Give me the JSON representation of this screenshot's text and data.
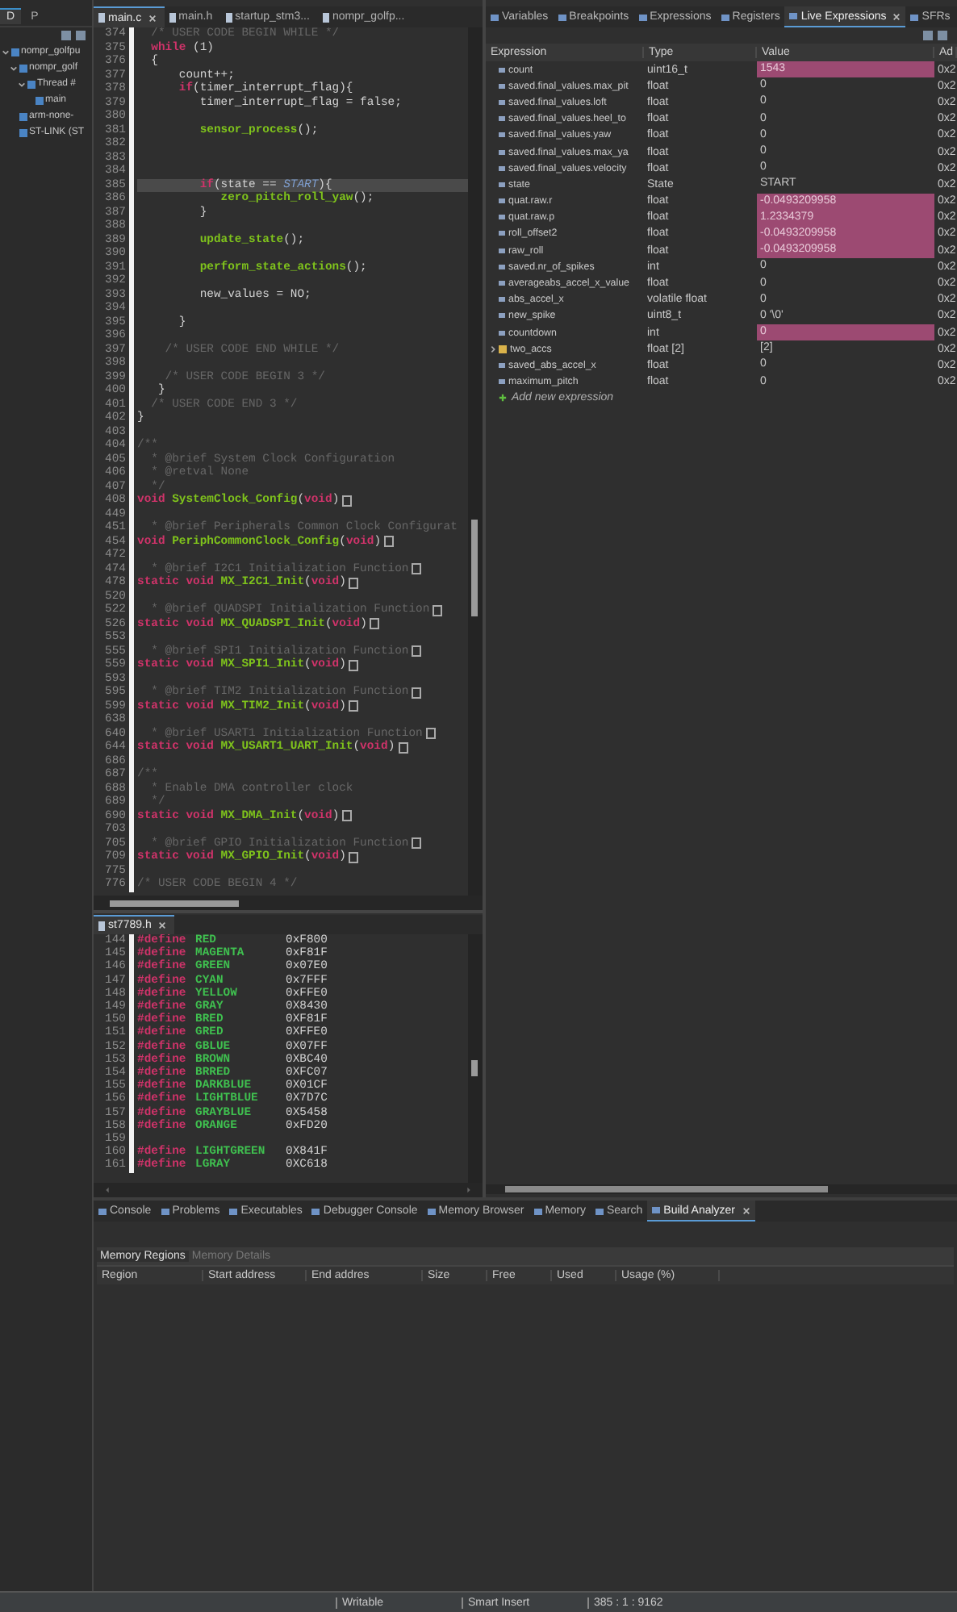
{
  "sidebar": {
    "tabs": [
      {
        "label": "D",
        "selected": true
      },
      {
        "label": "P",
        "selected": false
      }
    ],
    "tree": [
      {
        "label": "nompr_golfpu",
        "expanded": true,
        "children": [
          {
            "label": "nompr_golf",
            "expanded": true,
            "children": [
              {
                "label": "Thread #",
                "expanded": true,
                "children": [
                  {
                    "label": "main"
                  }
                ]
              }
            ]
          },
          {
            "label": "arm-none-"
          },
          {
            "label": "ST-LINK (ST"
          }
        ]
      }
    ]
  },
  "editor": {
    "tabs": [
      {
        "label": "main.c",
        "selected": true
      },
      {
        "label": "main.h",
        "selected": false
      },
      {
        "label": "startup_stm3...",
        "selected": false
      },
      {
        "label": "nompr_golfp...",
        "selected": false
      }
    ],
    "lines": [
      {
        "n": "374",
        "segs": [
          {
            "kind": "cm",
            "text": "  /* USER CODE BEGIN WHILE */"
          }
        ]
      },
      {
        "n": "375",
        "segs": [
          {
            "kind": "kw",
            "text": "  while"
          },
          {
            "kind": "tx",
            "text": " (1)"
          }
        ]
      },
      {
        "n": "376",
        "segs": [
          {
            "kind": "tx",
            "text": "  {"
          }
        ]
      },
      {
        "n": "377",
        "segs": [
          {
            "kind": "tx",
            "text": "      count++;"
          }
        ]
      },
      {
        "n": "378",
        "segs": [
          {
            "kind": "kw",
            "text": "      if"
          },
          {
            "kind": "tx",
            "text": "(timer_interrupt_flag){"
          }
        ]
      },
      {
        "n": "379",
        "segs": [
          {
            "kind": "tx",
            "text": "         timer_interrupt_flag = false;"
          }
        ]
      },
      {
        "n": "380"
      },
      {
        "n": "381",
        "segs": [
          {
            "kind": "fn",
            "text": "         sensor_process"
          },
          {
            "kind": "tx",
            "text": "();"
          }
        ]
      },
      {
        "n": "382"
      },
      {
        "n": "383"
      },
      {
        "n": "384"
      },
      {
        "n": "385",
        "current": true,
        "segs": [
          {
            "kind": "kw",
            "text": "         if"
          },
          {
            "kind": "tx",
            "text": "(state == "
          },
          {
            "kind": "const",
            "text": "START"
          },
          {
            "kind": "tx",
            "text": "){"
          }
        ]
      },
      {
        "n": "386",
        "segs": [
          {
            "kind": "fn",
            "text": "            zero_pitch_roll_yaw"
          },
          {
            "kind": "tx",
            "text": "();"
          }
        ]
      },
      {
        "n": "387",
        "segs": [
          {
            "kind": "tx",
            "text": "         }"
          }
        ]
      },
      {
        "n": "388"
      },
      {
        "n": "389",
        "segs": [
          {
            "kind": "fn",
            "text": "         update_state"
          },
          {
            "kind": "tx",
            "text": "();"
          }
        ]
      },
      {
        "n": "390"
      },
      {
        "n": "391",
        "segs": [
          {
            "kind": "fn",
            "text": "         perform_state_actions"
          },
          {
            "kind": "tx",
            "text": "();"
          }
        ]
      },
      {
        "n": "392"
      },
      {
        "n": "393",
        "segs": [
          {
            "kind": "tx",
            "text": "         new_values = NO;"
          }
        ]
      },
      {
        "n": "394"
      },
      {
        "n": "395",
        "segs": [
          {
            "kind": "tx",
            "text": "      }"
          }
        ]
      },
      {
        "n": "396"
      },
      {
        "n": "397",
        "segs": [
          {
            "kind": "cm",
            "text": "    /* USER CODE END WHILE */"
          }
        ]
      },
      {
        "n": "398"
      },
      {
        "n": "399",
        "segs": [
          {
            "kind": "cm",
            "text": "    /* USER CODE BEGIN 3 */"
          }
        ]
      },
      {
        "n": "400",
        "segs": [
          {
            "kind": "tx",
            "text": "   }"
          }
        ]
      },
      {
        "n": "401",
        "segs": [
          {
            "kind": "cm",
            "text": "  /* USER CODE END 3 */"
          }
        ]
      },
      {
        "n": "402",
        "segs": [
          {
            "kind": "tx",
            "text": "}"
          }
        ]
      },
      {
        "n": "403"
      },
      {
        "n": "404",
        "segs": [
          {
            "kind": "cm",
            "text": "/**"
          }
        ]
      },
      {
        "n": "405",
        "segs": [
          {
            "kind": "cm",
            "text": "  * @brief System Clock Configuration"
          }
        ]
      },
      {
        "n": "406",
        "segs": [
          {
            "kind": "cm",
            "text": "  * @retval None"
          }
        ]
      },
      {
        "n": "407",
        "segs": [
          {
            "kind": "cm",
            "text": "  */"
          }
        ]
      },
      {
        "n": "408",
        "folded": true,
        "segs": [
          {
            "kind": "kw",
            "text": "void "
          },
          {
            "kind": "fn",
            "text": "SystemClock_Config"
          },
          {
            "kind": "tx",
            "text": "("
          },
          {
            "kind": "kw",
            "text": "void"
          },
          {
            "kind": "tx",
            "text": ")"
          }
        ]
      },
      {
        "n": "449"
      },
      {
        "n": "451",
        "segs": [
          {
            "kind": "cm",
            "text": "  * @brief Peripherals Common Clock Configurat"
          }
        ]
      },
      {
        "n": "454",
        "folded": true,
        "segs": [
          {
            "kind": "kw",
            "text": "void "
          },
          {
            "kind": "fn",
            "text": "PeriphCommonClock_Config"
          },
          {
            "kind": "tx",
            "text": "("
          },
          {
            "kind": "kw",
            "text": "void"
          },
          {
            "kind": "tx",
            "text": ")"
          }
        ]
      },
      {
        "n": "472"
      },
      {
        "n": "474",
        "folded": true,
        "segs": [
          {
            "kind": "cm",
            "text": "  * @brief I2C1 Initialization Function"
          }
        ]
      },
      {
        "n": "478",
        "folded": true,
        "segs": [
          {
            "kind": "kw",
            "text": "static void "
          },
          {
            "kind": "fn",
            "text": "MX_I2C1_Init"
          },
          {
            "kind": "tx",
            "text": "("
          },
          {
            "kind": "kw",
            "text": "void"
          },
          {
            "kind": "tx",
            "text": ")"
          }
        ]
      },
      {
        "n": "520"
      },
      {
        "n": "522",
        "folded": true,
        "segs": [
          {
            "kind": "cm",
            "text": "  * @brief QUADSPI Initialization Function"
          }
        ]
      },
      {
        "n": "526",
        "folded": true,
        "segs": [
          {
            "kind": "kw",
            "text": "static void "
          },
          {
            "kind": "fn",
            "text": "MX_QUADSPI_Init"
          },
          {
            "kind": "tx",
            "text": "("
          },
          {
            "kind": "kw",
            "text": "void"
          },
          {
            "kind": "tx",
            "text": ")"
          }
        ]
      },
      {
        "n": "553"
      },
      {
        "n": "555",
        "folded": true,
        "segs": [
          {
            "kind": "cm",
            "text": "  * @brief SPI1 Initialization Function"
          }
        ]
      },
      {
        "n": "559",
        "folded": true,
        "segs": [
          {
            "kind": "kw",
            "text": "static void "
          },
          {
            "kind": "fn",
            "text": "MX_SPI1_Init"
          },
          {
            "kind": "tx",
            "text": "("
          },
          {
            "kind": "kw",
            "text": "void"
          },
          {
            "kind": "tx",
            "text": ")"
          }
        ]
      },
      {
        "n": "593"
      },
      {
        "n": "595",
        "folded": true,
        "segs": [
          {
            "kind": "cm",
            "text": "  * @brief TIM2 Initialization Function"
          }
        ]
      },
      {
        "n": "599",
        "folded": true,
        "segs": [
          {
            "kind": "kw",
            "text": "static void "
          },
          {
            "kind": "fn",
            "text": "MX_TIM2_Init"
          },
          {
            "kind": "tx",
            "text": "("
          },
          {
            "kind": "kw",
            "text": "void"
          },
          {
            "kind": "tx",
            "text": ")"
          }
        ]
      },
      {
        "n": "638"
      },
      {
        "n": "640",
        "folded": true,
        "segs": [
          {
            "kind": "cm",
            "text": "  * @brief USART1 Initialization Function"
          }
        ]
      },
      {
        "n": "644",
        "folded": true,
        "segs": [
          {
            "kind": "kw",
            "text": "static void "
          },
          {
            "kind": "fn",
            "text": "MX_USART1_UART_Init"
          },
          {
            "kind": "tx",
            "text": "("
          },
          {
            "kind": "kw",
            "text": "void"
          },
          {
            "kind": "tx",
            "text": ")"
          }
        ]
      },
      {
        "n": "686"
      },
      {
        "n": "687",
        "segs": [
          {
            "kind": "cm",
            "text": "/**"
          }
        ]
      },
      {
        "n": "688",
        "segs": [
          {
            "kind": "cm",
            "text": "  * Enable DMA controller clock"
          }
        ]
      },
      {
        "n": "689",
        "segs": [
          {
            "kind": "cm",
            "text": "  */"
          }
        ]
      },
      {
        "n": "690",
        "folded": true,
        "segs": [
          {
            "kind": "kw",
            "text": "static void "
          },
          {
            "kind": "fn",
            "text": "MX_DMA_Init"
          },
          {
            "kind": "tx",
            "text": "("
          },
          {
            "kind": "kw",
            "text": "void"
          },
          {
            "kind": "tx",
            "text": ")"
          }
        ]
      },
      {
        "n": "703"
      },
      {
        "n": "705",
        "folded": true,
        "segs": [
          {
            "kind": "cm",
            "text": "  * @brief GPIO Initialization Function"
          }
        ]
      },
      {
        "n": "709",
        "folded": true,
        "segs": [
          {
            "kind": "kw",
            "text": "static void "
          },
          {
            "kind": "fn",
            "text": "MX_GPIO_Init"
          },
          {
            "kind": "tx",
            "text": "("
          },
          {
            "kind": "kw",
            "text": "void"
          },
          {
            "kind": "tx",
            "text": ")"
          }
        ]
      },
      {
        "n": "775"
      },
      {
        "n": "776",
        "segs": [
          {
            "kind": "cm",
            "text": "/* USER CODE BEGIN 4 */"
          }
        ]
      }
    ]
  },
  "header_editor": {
    "tab": "st7789.h",
    "lines": [
      {
        "n": "144",
        "directive": "#define",
        "name": "RED",
        "value": "0xF800"
      },
      {
        "n": "145",
        "directive": "#define",
        "name": "MAGENTA",
        "value": "0xF81F"
      },
      {
        "n": "146",
        "directive": "#define",
        "name": "GREEN",
        "value": "0x07E0"
      },
      {
        "n": "147",
        "directive": "#define",
        "name": "CYAN",
        "value": "0x7FFF"
      },
      {
        "n": "148",
        "directive": "#define",
        "name": "YELLOW",
        "value": "0xFFE0"
      },
      {
        "n": "149",
        "directive": "#define",
        "name": "GRAY",
        "value": "0X8430"
      },
      {
        "n": "150",
        "directive": "#define",
        "name": "BRED",
        "value": "0XF81F"
      },
      {
        "n": "151",
        "directive": "#define",
        "name": "GRED",
        "value": "0XFFE0"
      },
      {
        "n": "152",
        "directive": "#define",
        "name": "GBLUE",
        "value": "0X07FF"
      },
      {
        "n": "153",
        "directive": "#define",
        "name": "BROWN",
        "value": "0XBC40"
      },
      {
        "n": "154",
        "directive": "#define",
        "name": "BRRED",
        "value": "0XFC07"
      },
      {
        "n": "155",
        "directive": "#define",
        "name": "DARKBLUE",
        "value": "0X01CF"
      },
      {
        "n": "156",
        "directive": "#define",
        "name": "LIGHTBLUE",
        "value": "0X7D7C"
      },
      {
        "n": "157",
        "directive": "#define",
        "name": "GRAYBLUE",
        "value": "0X5458"
      },
      {
        "n": "158",
        "directive": "#define",
        "name": "ORANGE",
        "value": "0xFD20"
      },
      {
        "n": "159"
      },
      {
        "n": "160",
        "directive": "#define",
        "name": "LIGHTGREEN",
        "value": "0X841F"
      },
      {
        "n": "161",
        "directive": "#define",
        "name": "LGRAY",
        "value": "0XC618"
      }
    ]
  },
  "debug_panel": {
    "tabs": [
      {
        "label": "Variables",
        "selected": false
      },
      {
        "label": "Breakpoints",
        "selected": false
      },
      {
        "label": "Expressions",
        "selected": false
      },
      {
        "label": "Registers",
        "selected": false
      },
      {
        "label": "Live Expressions",
        "selected": true
      },
      {
        "label": "SFRs",
        "selected": false
      }
    ],
    "columns": [
      "Expression",
      "Type",
      "Value",
      "Ad"
    ],
    "rows": [
      {
        "expression": "count",
        "type": "uint16_t",
        "value": "1543",
        "column_4": "0x2",
        "changed": true
      },
      {
        "expression": "saved.final_values.max_pit",
        "type": "float",
        "value": "0",
        "column_4": "0x2",
        "changed": false
      },
      {
        "expression": "saved.final_values.loft",
        "type": "float",
        "value": "0",
        "column_4": "0x2",
        "changed": false
      },
      {
        "expression": "saved.final_values.heel_to",
        "type": "float",
        "value": "0",
        "column_4": "0x2",
        "changed": false
      },
      {
        "expression": "saved.final_values.yaw",
        "type": "float",
        "value": "0",
        "column_4": "0x2",
        "changed": false
      },
      {
        "expression": "saved.final_values.max_ya",
        "type": "float",
        "value": "0",
        "column_4": "0x2",
        "changed": false
      },
      {
        "expression": "saved.final_values.velocity",
        "type": "float",
        "value": "0",
        "column_4": "0x2",
        "changed": false
      },
      {
        "expression": "state",
        "type": "State",
        "value": "START",
        "column_4": "0x2",
        "changed": false
      },
      {
        "expression": "quat.raw.r",
        "type": "float",
        "value": "-0.0493209958",
        "column_4": "0x2",
        "changed": true
      },
      {
        "expression": "quat.raw.p",
        "type": "float",
        "value": "1.2334379",
        "column_4": "0x2",
        "changed": true
      },
      {
        "expression": "roll_offset2",
        "type": "float",
        "value": "-0.0493209958",
        "column_4": "0x2",
        "changed": true
      },
      {
        "expression": "raw_roll",
        "type": "float",
        "value": "-0.0493209958",
        "column_4": "0x2",
        "changed": true
      },
      {
        "expression": "saved.nr_of_spikes",
        "type": "int",
        "value": "0",
        "column_4": "0x2",
        "changed": false
      },
      {
        "expression": "averageabs_accel_x_value",
        "type": "float",
        "value": "0",
        "column_4": "0x2",
        "changed": false
      },
      {
        "expression": "abs_accel_x",
        "type": "volatile float",
        "value": "0",
        "column_4": "0x2",
        "changed": false
      },
      {
        "expression": "new_spike",
        "type": "uint8_t",
        "value": "0 '\\0'",
        "column_4": "0x2",
        "changed": false
      },
      {
        "expression": "countdown",
        "type": "int",
        "value": "0",
        "column_4": "0x2",
        "changed": true
      },
      {
        "expression": "two_accs",
        "type": "float [2]",
        "value": "[2]",
        "column_4": "0x2",
        "changed": false,
        "expanded": false
      },
      {
        "expression": "saved_abs_accel_x",
        "type": "float",
        "value": "0",
        "column_4": "0x2",
        "changed": false
      },
      {
        "expression": "maximum_pitch",
        "type": "float",
        "value": "0",
        "column_4": "0x2",
        "changed": false
      }
    ],
    "add_label": "Add new expression"
  },
  "bottom_panel": {
    "tabs": [
      {
        "label": "Console",
        "selected": false
      },
      {
        "label": "Problems",
        "selected": false
      },
      {
        "label": "Executables",
        "selected": false
      },
      {
        "label": "Debugger Console",
        "selected": false
      },
      {
        "label": "Memory Browser",
        "selected": false
      },
      {
        "label": "Memory",
        "selected": false
      },
      {
        "label": "Search",
        "selected": false
      },
      {
        "label": "Build Analyzer",
        "selected": true
      }
    ],
    "subtabs": [
      {
        "label": "Memory Regions",
        "selected": true
      },
      {
        "label": "Memory Details",
        "selected": false
      }
    ],
    "columns": [
      "Region",
      "Start address",
      "End addres",
      "Size",
      "Free",
      "Used",
      "Usage (%)"
    ]
  },
  "status_bar": [
    "Writable",
    "Smart Insert",
    "385 : 1 : 9162"
  ]
}
